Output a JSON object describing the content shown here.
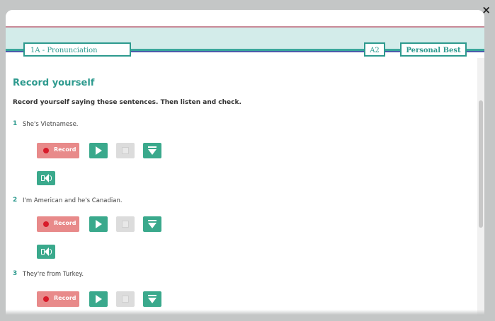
{
  "window": {
    "close_label": "×"
  },
  "header": {
    "unit_label": "1A - Pronunciation",
    "level_label": "A2",
    "brand_label": "Personal Best"
  },
  "section": {
    "title": "Record yourself",
    "instruction": "Record yourself saying these sentences. Then listen and check."
  },
  "controls": {
    "record_label": "Record"
  },
  "items": [
    {
      "number": "1",
      "text": "She's Vietnamese."
    },
    {
      "number": "2",
      "text": "I'm American and he's Canadian."
    },
    {
      "number": "3",
      "text": "They're from Turkey."
    }
  ],
  "icons": {
    "record": "record-dot-icon",
    "play": "play-icon",
    "stop": "stop-icon",
    "download": "download-icon",
    "audio": "speaker-icon",
    "close": "close-icon"
  },
  "colors": {
    "accent": "#2d9a8e",
    "button_green": "#3aa98c",
    "record_red": "#e88a8a",
    "header_tint": "#d3ecea"
  }
}
